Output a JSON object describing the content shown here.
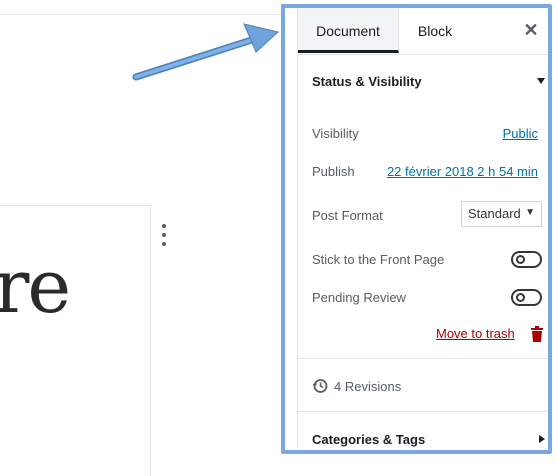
{
  "sidebar": {
    "tabs": [
      {
        "label": "Document",
        "active": true
      },
      {
        "label": "Block",
        "active": false
      }
    ],
    "close_icon": "close-icon",
    "status_visibility": {
      "title": "Status & Visibility",
      "visibility_label": "Visibility",
      "visibility_value": "Public",
      "publish_label": "Publish",
      "publish_value": "22 février 2018 2 h 54 min",
      "post_format_label": "Post Format",
      "post_format_value": "Standard",
      "sticky_label": "Stick to the Front Page",
      "sticky_on": false,
      "pending_label": "Pending Review",
      "pending_on": false,
      "trash_label": "Move to trash"
    },
    "revisions_label": "4 Revisions",
    "categories_title": "Categories & Tags"
  },
  "editor": {
    "block_text": "re"
  },
  "colors": {
    "accent_link": "#0073aa",
    "trash": "#a00000",
    "highlight_border": "#7aa9df"
  }
}
